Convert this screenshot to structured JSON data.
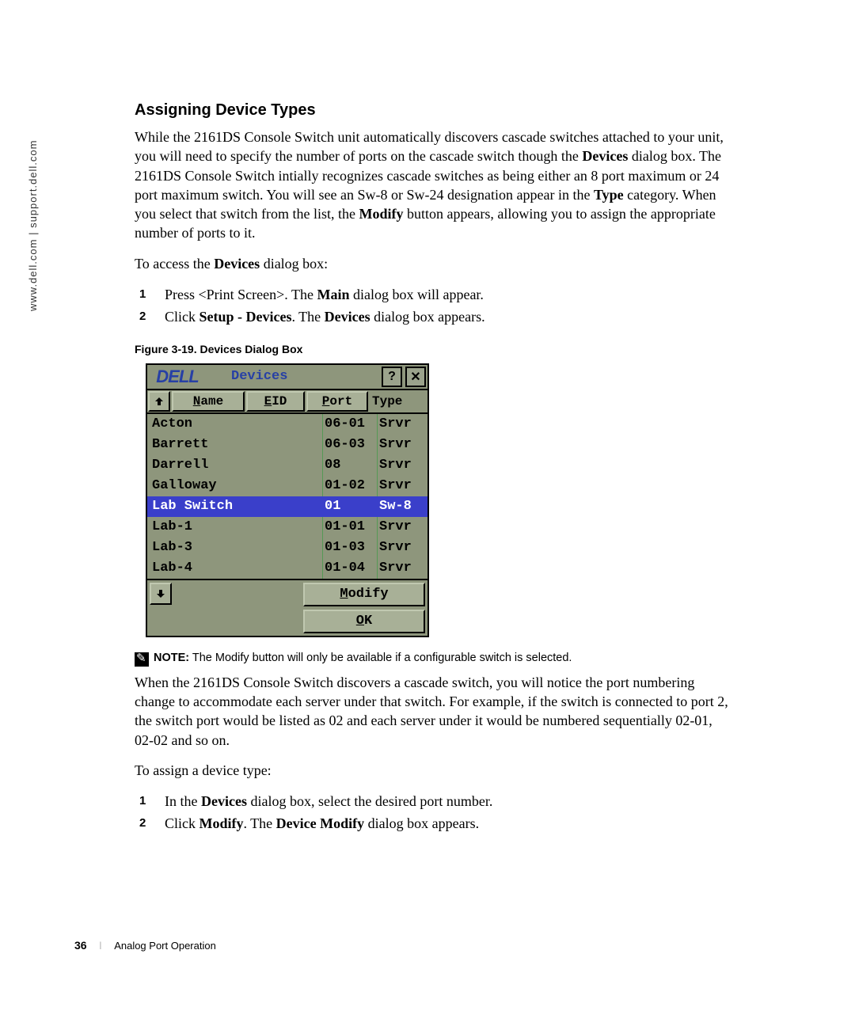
{
  "sidebar_text": "www.dell.com | support.dell.com",
  "section_title": "Assigning Device Types",
  "para1_a": "While the 2161DS Console Switch unit automatically discovers cascade switches attached to your unit, you will need to specify the number of ports on the cascade switch though the ",
  "para1_b": "Devices",
  "para1_c": " dialog box. The 2161DS Console Switch intially recognizes cascade switches as being either an 8 port maximum or 24 port maximum switch. You will see an Sw-8 or Sw-24 designation appear in the ",
  "para1_d": "Type",
  "para1_e": " category. When you select that switch from the list, the ",
  "para1_f": "Modify",
  "para1_g": " button appears, allowing you to assign the appropriate number of ports to it.",
  "para2_a": "To access the ",
  "para2_b": "Devices",
  "para2_c": " dialog box:",
  "steps1": {
    "s1_a": "Press <Print Screen>. The ",
    "s1_b": "Main",
    "s1_c": " dialog box will appear.",
    "s2_a": "Click ",
    "s2_b": "Setup - Devices",
    "s2_c": ". The ",
    "s2_d": "Devices",
    "s2_e": " dialog box appears."
  },
  "fig_caption": "Figure 3-19.    Devices Dialog Box",
  "dialog": {
    "logo": "DELL",
    "title": "Devices",
    "help": "?",
    "close": "✕",
    "headers": {
      "name": "Name",
      "eid": "EID",
      "port": "Port",
      "type": "Type"
    },
    "scroll_up": "⬆",
    "scroll_down": "⬇",
    "rows": [
      {
        "name": "Acton",
        "port": "06-01",
        "type": "Srvr",
        "sel": false
      },
      {
        "name": "Barrett",
        "port": "06-03",
        "type": "Srvr",
        "sel": false
      },
      {
        "name": "Darrell",
        "port": "08",
        "type": "Srvr",
        "sel": false
      },
      {
        "name": "Galloway",
        "port": "01-02",
        "type": "Srvr",
        "sel": false
      },
      {
        "name": "Lab Switch",
        "port": "01",
        "type": "Sw-8",
        "sel": true
      },
      {
        "name": "Lab-1",
        "port": "01-01",
        "type": "Srvr",
        "sel": false
      },
      {
        "name": "Lab-3",
        "port": "01-03",
        "type": "Srvr",
        "sel": false
      },
      {
        "name": "Lab-4",
        "port": "01-04",
        "type": "Srvr",
        "sel": false
      }
    ],
    "modify": "Modify",
    "ok": "OK"
  },
  "note_label": "NOTE:",
  "note_text_a": " The ",
  "note_text_b": "Modify",
  "note_text_c": " button will only be available if a configurable switch is selected.",
  "para3": "When the 2161DS Console Switch discovers a cascade switch, you will notice the port numbering change to accommodate each server under that switch. For example, if the switch is connected to port 2, the switch port would be listed as 02 and each server under it would be numbered sequentially 02-01, 02-02 and so on.",
  "para4": "To assign a device type:",
  "steps2": {
    "s1_a": "In the ",
    "s1_b": "Devices",
    "s1_c": " dialog box, select the desired port number.",
    "s2_a": "Click ",
    "s2_b": "Modify",
    "s2_c": ". The ",
    "s2_d": "Device Modify",
    "s2_e": " dialog box appears."
  },
  "footer": {
    "page": "36",
    "section": "Analog Port Operation"
  }
}
